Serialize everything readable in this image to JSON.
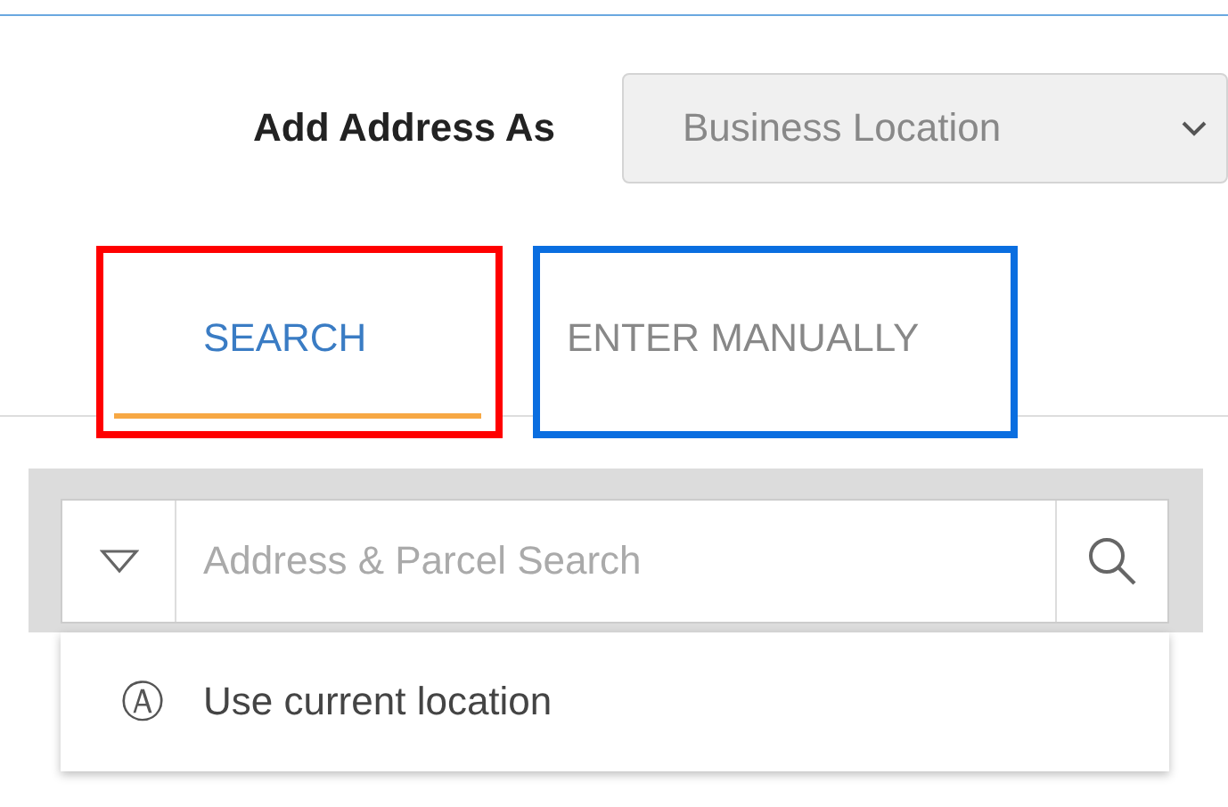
{
  "add_address_as": {
    "label": "Add Address As",
    "value": "Business Location"
  },
  "tabs": [
    {
      "label": "SEARCH",
      "selected": true,
      "color": "#ff0000"
    },
    {
      "label": "ENTER MANUALLY",
      "selected": false,
      "color": "#0a6ee0"
    }
  ],
  "search": {
    "placeholder": "Address & Parcel Search"
  },
  "suggestions": [
    {
      "icon": "Ⓐ",
      "label": "Use current location"
    }
  ]
}
